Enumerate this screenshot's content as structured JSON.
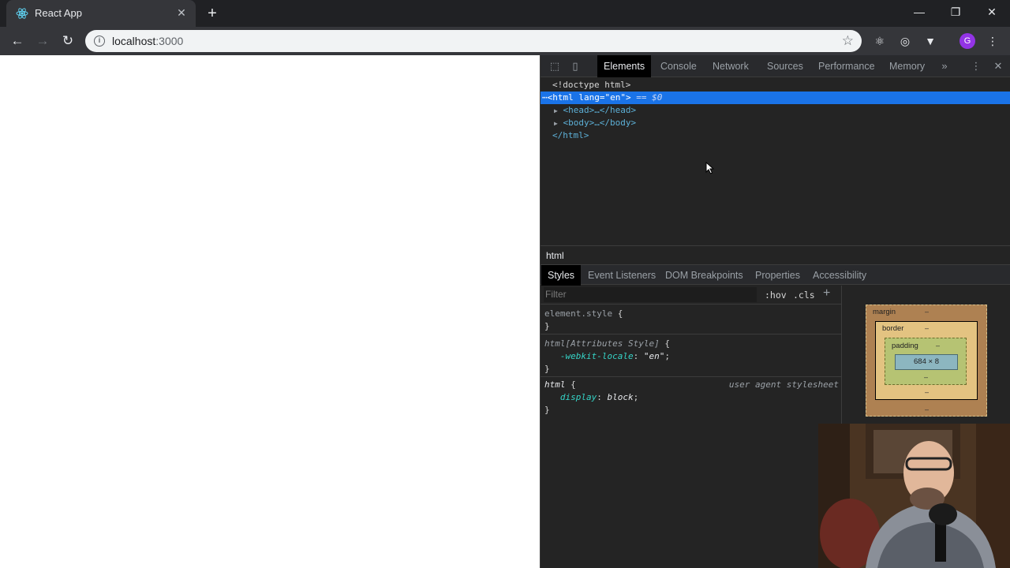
{
  "browser": {
    "tab_title": "React App",
    "new_tab_icon": "plus-icon",
    "window_controls": [
      "minimize",
      "restore",
      "close"
    ]
  },
  "toolbar": {
    "url_host": "localhost",
    "url_port": ":3000"
  },
  "devtools": {
    "tabs": [
      "Elements",
      "Console",
      "Network",
      "Sources",
      "Performance",
      "Memory"
    ],
    "active_tab": "Elements",
    "dom": {
      "doctype": "<!doctype html>",
      "html_open": "<html",
      "html_attr": "lang",
      "html_attr_val": "\"en\"",
      "html_close_bracket": ">",
      "selected_marker": "== $0",
      "head": "<head>…</head>",
      "body": "<body>…</body>",
      "html_end": "</html>"
    },
    "breadcrumb": "html",
    "subtabs": [
      "Styles",
      "Event Listeners",
      "DOM Breakpoints",
      "Properties",
      "Accessibility"
    ],
    "active_subtab": "Styles",
    "filter_placeholder": "Filter",
    "hov": ":hov",
    "cls": ".cls",
    "rules": {
      "element_style_selector": "element.style",
      "attr_style_selector": "html[Attributes Style]",
      "attr_prop": "-webkit-locale",
      "attr_val": "\"en\"",
      "html_selector": "html",
      "html_source": "user agent stylesheet",
      "html_prop": "display",
      "html_val": "block"
    },
    "box_model": {
      "margin_label": "margin",
      "border_label": "border",
      "padding_label": "padding",
      "content_size": "684 × 8",
      "dash": "–"
    }
  },
  "colors": {
    "accent_selected": "#1a73e8",
    "avatar": "#9334e6"
  }
}
